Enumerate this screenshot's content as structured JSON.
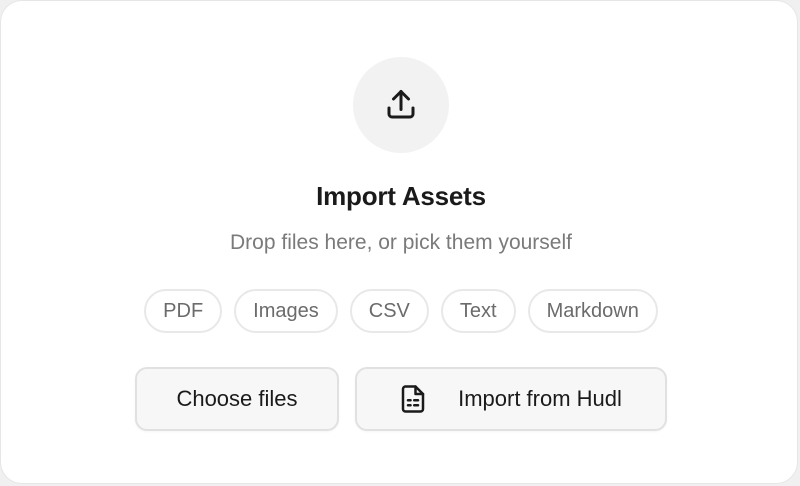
{
  "dropzone": {
    "title": "Import Assets",
    "subtitle": "Drop files here, or pick them yourself",
    "upload_icon": "upload-tray-icon",
    "file_types": [
      "PDF",
      "Images",
      "CSV",
      "Text",
      "Markdown"
    ],
    "actions": {
      "choose_label": "Choose files",
      "import_label": "Import from Hudl",
      "import_icon": "document-icon"
    }
  },
  "colors": {
    "card_bg": "#ffffff",
    "page_bg": "#f0f0f0",
    "title": "#1a1a1a",
    "muted_text": "#7a7a7a",
    "chip_border": "#e8e8e8",
    "button_bg": "#f7f7f7"
  }
}
